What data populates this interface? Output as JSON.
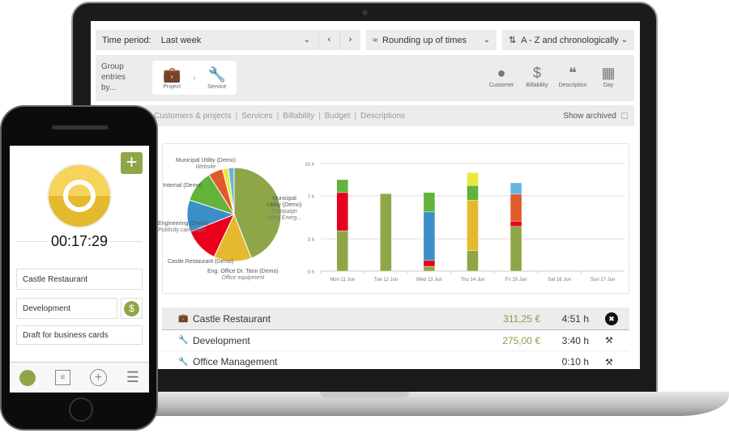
{
  "toolbar": {
    "time_period_label": "Time period:",
    "time_period_value": "Last week",
    "rounding": "Rounding up of times",
    "sorting": "A - Z and chronologically"
  },
  "grouping": {
    "label": "Group entries by...",
    "selected": [
      {
        "label": "Project",
        "icon": "briefcase-icon"
      },
      {
        "label": "Service",
        "icon": "wrench-icon"
      }
    ],
    "available": [
      {
        "label": "Customer",
        "icon": "person-icon"
      },
      {
        "label": "Billability",
        "icon": "dollar-icon"
      },
      {
        "label": "Description",
        "icon": "quote-icon"
      },
      {
        "label": "Day",
        "icon": "calendar-icon"
      }
    ]
  },
  "tabs": {
    "items": [
      "Customers & projects",
      "Services",
      "Billability",
      "Budget",
      "Descriptions"
    ],
    "show_archived": "Show archived"
  },
  "chart_data": [
    {
      "type": "pie",
      "labels": [
        {
          "customer": "Municipal Utility (Demo)",
          "project": "Campaign Wind Energ..."
        },
        {
          "customer": "Eng. Office Dr. Tann (Demo)",
          "project": "Office equipment"
        },
        {
          "customer": "Castle Restaurant (Demo)",
          "project": ""
        },
        {
          "customer": "Engineering (Demo)",
          "project": "Publicity campaign"
        },
        {
          "customer": "Internal (Demo)",
          "project": ""
        },
        {
          "customer": "Municipal Utility (Demo)",
          "project": "Website"
        }
      ],
      "values": [
        44,
        13,
        12,
        11,
        11,
        5,
        2,
        2
      ],
      "colors": [
        "#8fa648",
        "#e5b92e",
        "#e8001c",
        "#3a8fc8",
        "#63b33a",
        "#e05a2a",
        "#ece83a",
        "#66b5e0"
      ]
    },
    {
      "type": "bar",
      "stacked": true,
      "categories": [
        "Mon 11 Jun",
        "Tue 12 Jun",
        "Wed 13 Jun",
        "Thu 14 Jun",
        "Fri 15 Jun",
        "Sat 16 Jun",
        "Sun 17 Jun"
      ],
      "yticks": [
        "0 h",
        "3 h",
        "7 h",
        "10 h"
      ],
      "ylim": [
        0,
        10
      ],
      "grid": true,
      "series": [
        {
          "color": "#8fa648",
          "values": [
            3.75,
            7.2,
            0.45,
            1.9,
            4.15,
            0,
            0
          ]
        },
        {
          "color": "#e8001c",
          "values": [
            3.55,
            0,
            0.55,
            0,
            0.5,
            0,
            0
          ]
        },
        {
          "color": "#3a8fc8",
          "values": [
            0,
            0,
            4.5,
            0,
            0,
            0,
            0
          ]
        },
        {
          "color": "#e5b92e",
          "values": [
            0,
            0,
            0,
            4.7,
            0,
            0,
            0
          ]
        },
        {
          "color": "#e05a2a",
          "values": [
            0,
            0,
            0,
            0,
            2.5,
            0,
            0
          ]
        },
        {
          "color": "#63b33a",
          "values": [
            1.2,
            0,
            1.8,
            1.35,
            0,
            0,
            0
          ]
        },
        {
          "color": "#ece83a",
          "values": [
            0,
            0,
            0,
            1.2,
            0,
            0,
            0
          ]
        },
        {
          "color": "#66b5e0",
          "values": [
            0,
            0,
            0,
            0,
            1.05,
            0,
            0
          ]
        }
      ]
    }
  ],
  "table": [
    {
      "name": "Castle Restaurant",
      "amount": "311,25 €",
      "hours": "4:51 h",
      "icon": "briefcase-icon"
    },
    {
      "name": "Development",
      "amount": "275,00 €",
      "hours": "3:40 h",
      "icon": "wrench-icon"
    },
    {
      "name": "Office Management",
      "amount": "",
      "hours": "0:10 h",
      "icon": "wrench-icon"
    }
  ],
  "phone": {
    "timer": "00:17:29",
    "customer": "Castle Restaurant",
    "service": "Development",
    "description": "Draft for business cards"
  },
  "colors": {
    "accent": "#8fa648",
    "timer": "#e5b92e"
  }
}
